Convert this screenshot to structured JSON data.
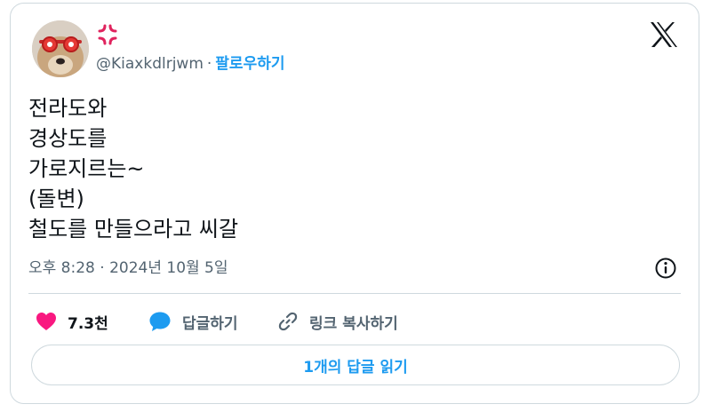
{
  "author": {
    "handle": "@Kiaxkdlrjwm",
    "separator": "·",
    "follow_label": "팔로우하기",
    "avatar_icon": "dog-with-red-glasses-avatar",
    "emoji_icon": "anger-symbol-icon"
  },
  "tweet": {
    "lines": [
      "전라도와",
      "경상도를",
      "가로지르는~",
      "(돌변)",
      "철도를 만들으라고 씨갈"
    ],
    "timestamp": "오후 8:28 · 2024년 10월 5일"
  },
  "actions": {
    "like_count": "7.3천",
    "reply_label": "답글하기",
    "copy_link_label": "링크 복사하기"
  },
  "read_replies_label": "1개의 답글 읽기",
  "colors": {
    "like": "#f91880",
    "accent": "#1d9bf0",
    "secondary_text": "#536471",
    "border": "#cfd9de"
  }
}
